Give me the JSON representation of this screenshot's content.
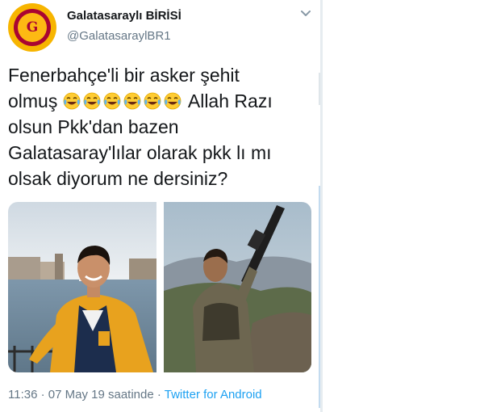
{
  "tweet": {
    "display_name": "Galatasaraylı BİRİSİ",
    "handle": "@GalatasaraylBR1",
    "avatar_icon": "galatasaray-crest-icon",
    "text_line1": "Fenerbahçe'li bir asker şehit",
    "text_line2_start": "olmuş",
    "emojis": [
      "face-with-tears-of-joy-icon",
      "face-with-tears-of-joy-icon",
      "face-with-tears-of-joy-icon",
      "face-with-tears-of-joy-icon",
      "face-with-tears-of-joy-icon",
      "face-with-tears-of-joy-icon"
    ],
    "text_line2_end": "Allah",
    "text_rest": "Razı olsun Pkk'dan bazen Galatasaray'lılar olarak pkk lı mı olsak diyorum ne dersiniz?",
    "media": [
      "smiling-man-photo",
      "soldier-with-rifle-photo"
    ],
    "time": "11:36",
    "separator": " · ",
    "date": "07 May 19 saatinde",
    "dot": " · ",
    "source": "Twitter for Android"
  },
  "colors": {
    "text": "#14171a",
    "secondary": "#657786",
    "link": "#1da1f2",
    "galatasaray_red": "#a90432",
    "galatasaray_yellow": "#fdb913"
  }
}
